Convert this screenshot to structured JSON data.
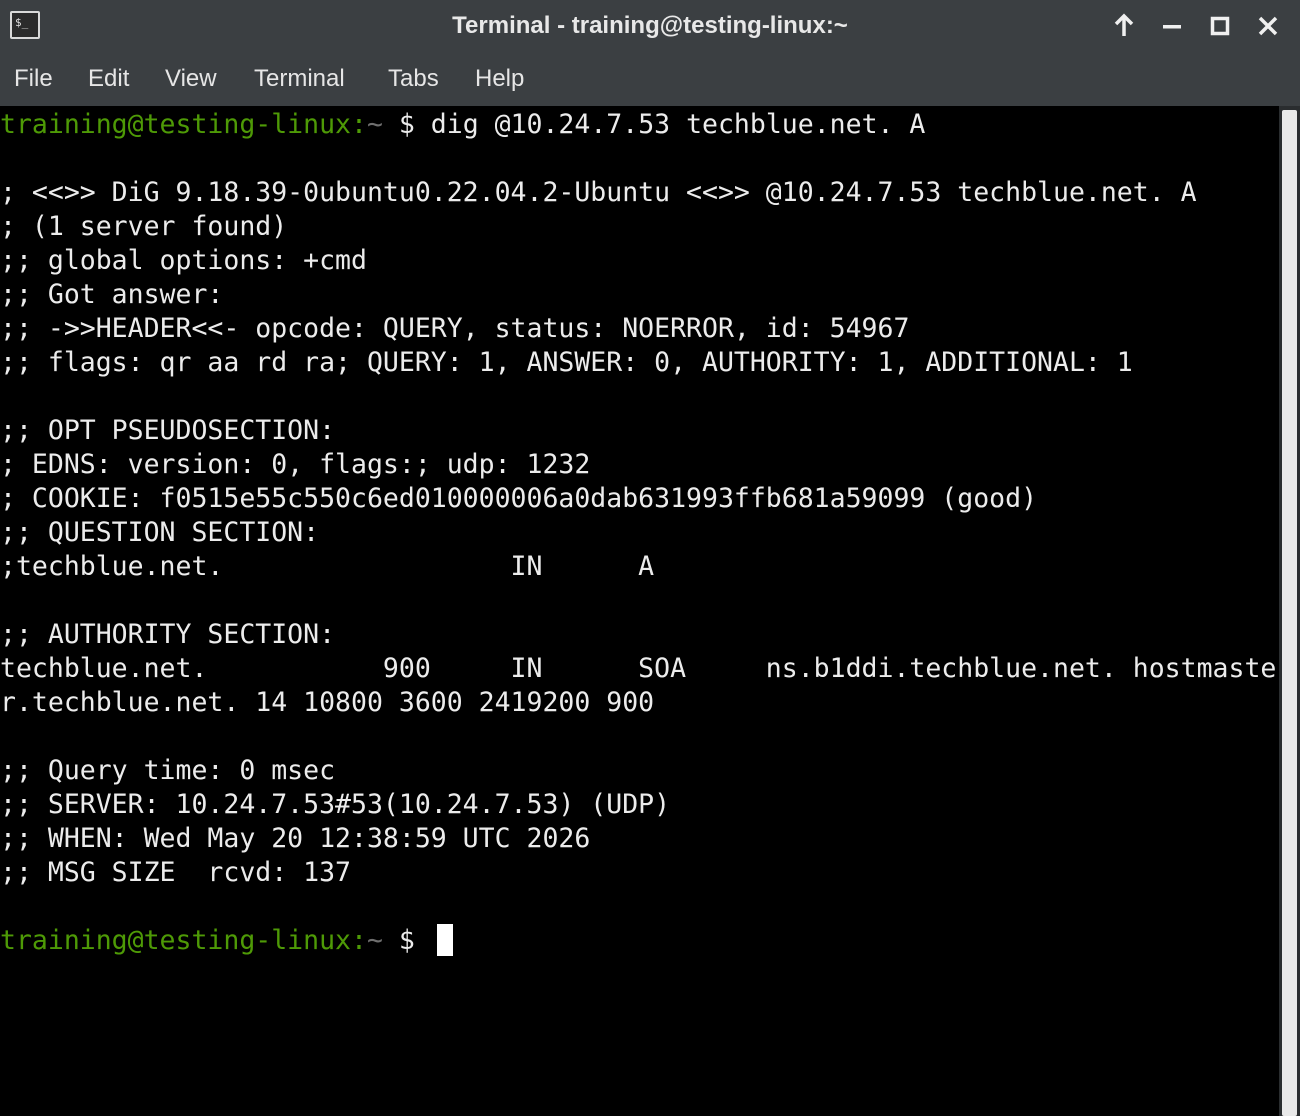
{
  "window": {
    "title": "Terminal - training@testing-linux:~"
  },
  "titlebar_buttons": {
    "above": "arrow-up-icon",
    "minimize": "minimize-icon",
    "maximize": "maximize-icon",
    "close": "close-icon"
  },
  "menu": {
    "items": [
      "File",
      "Edit",
      "View",
      "Terminal",
      "Tabs",
      "Help"
    ]
  },
  "terminal": {
    "prompt_user": "training@testing-linux:",
    "prompt_path": "~",
    "prompt_symbol": " $ ",
    "command": "dig @10.24.7.53 techblue.net. A",
    "output": [
      "; <<>> DiG 9.18.39-0ubuntu0.22.04.2-Ubuntu <<>> @10.24.7.53 techblue.net. A",
      "; (1 server found)",
      ";; global options: +cmd",
      ";; Got answer:",
      ";; ->>HEADER<<- opcode: QUERY, status: NOERROR, id: 54967",
      ";; flags: qr aa rd ra; QUERY: 1, ANSWER: 0, AUTHORITY: 1, ADDITIONAL: 1",
      ";; OPT PSEUDOSECTION:",
      "; EDNS: version: 0, flags:; udp: 1232",
      "; COOKIE: f0515e55c550c6ed010000006a0dab631993ffb681a59099 (good)",
      ";; QUESTION SECTION:",
      ";techblue.net.                  IN      A",
      ";; AUTHORITY SECTION:",
      "techblue.net.           900     IN      SOA     ns.b1ddi.techblue.net. hostmaste",
      "r.techblue.net. 14 10800 3600 2419200 900",
      ";; Query time: 0 msec",
      ";; SERVER: 10.24.7.53#53(10.24.7.53) (UDP)",
      ";; WHEN: Wed May 20 12:38:59 UTC 2026",
      ";; MSG SIZE  rcvd: 137"
    ]
  },
  "colors": {
    "titlebar_bg": "#3b3f42",
    "terminal_bg": "#000000",
    "text": "#ececec",
    "prompt_user": "#4e9a06",
    "prompt_path": "#6f6f6f"
  }
}
